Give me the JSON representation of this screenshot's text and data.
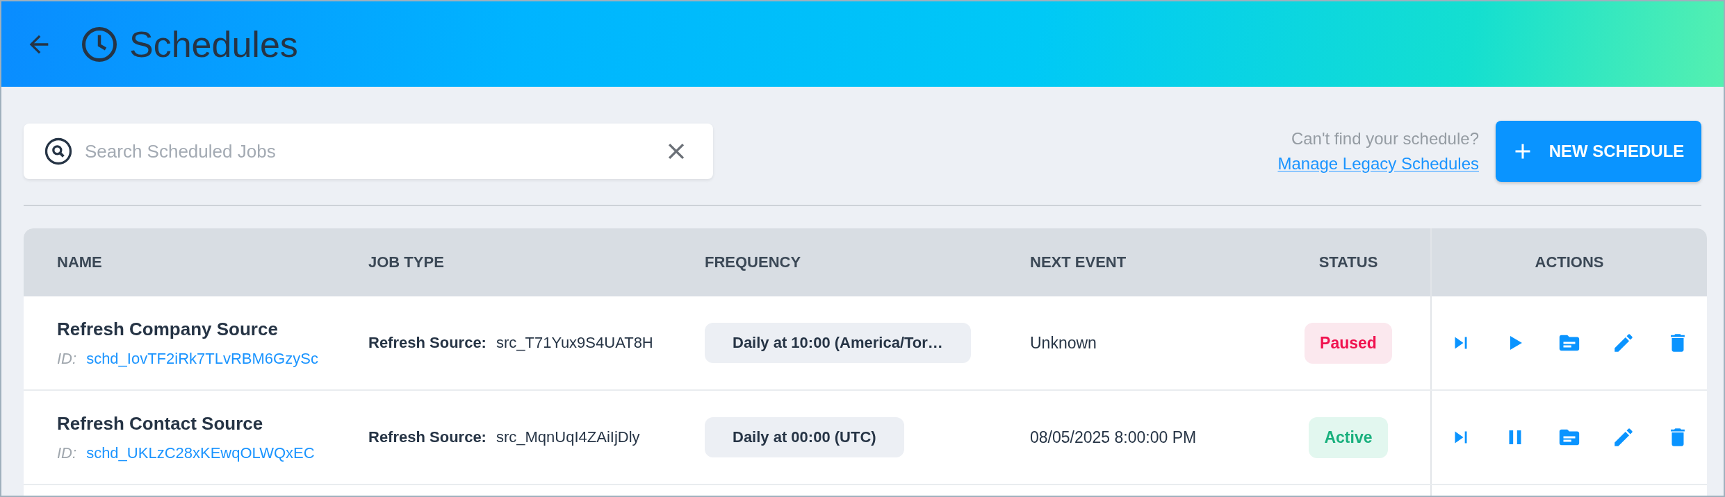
{
  "header": {
    "title": "Schedules"
  },
  "search": {
    "placeholder": "Search Scheduled Jobs"
  },
  "legacy": {
    "question": "Can't find your schedule?",
    "link": "Manage Legacy Schedules"
  },
  "new_button": "NEW SCHEDULE",
  "table": {
    "columns": [
      "NAME",
      "JOB TYPE",
      "FREQUENCY",
      "NEXT EVENT",
      "STATUS",
      "ACTIONS"
    ],
    "rows": [
      {
        "name": "Refresh Company Source",
        "id_label": "ID:",
        "id": "schd_IovTF2iRk7TLvRBM6GzySc",
        "job_label": "Refresh Source:",
        "job_value": "src_T71Yux9S4UAT8H",
        "frequency": "Daily at 10:00 (America/Tor…",
        "next_event": "Unknown",
        "status": {
          "label": "Paused",
          "kind": "paused"
        }
      },
      {
        "name": "Refresh Contact Source",
        "id_label": "ID:",
        "id": "schd_UKLzC28xKEwqOLWQxEC",
        "job_label": "Refresh Source:",
        "job_value": "src_MqnUqI4ZAiIjDly",
        "frequency": "Daily at 00:00 (UTC)",
        "next_event": "08/05/2025 8:00:00 PM",
        "status": {
          "label": "Active",
          "kind": "active"
        }
      }
    ]
  }
}
